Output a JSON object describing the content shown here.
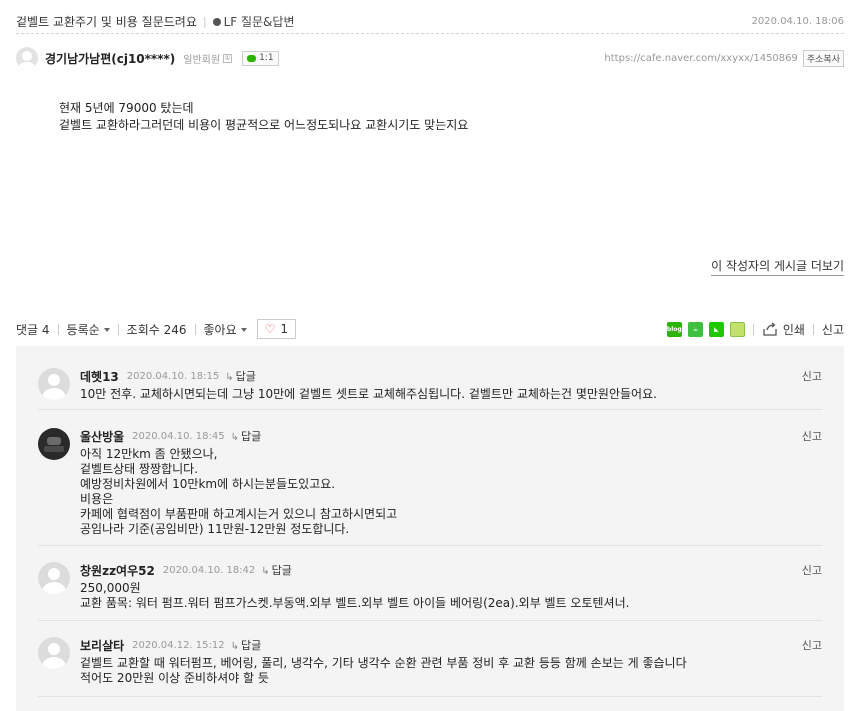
{
  "post": {
    "title": "겉벨트 교환주기 및 비용 질문드려요",
    "board": "LF 질문&답변",
    "date": "2020.04.10. 18:06",
    "author": "경기남가남편(cj10****)",
    "member_grade": "일반회원",
    "grade_icon": "①",
    "chat_label": "1:1",
    "url": "https://cafe.naver.com/xxyxx/1450869",
    "copy_label": "주소복사",
    "body_lines": [
      "현재 5년에 79000 탔는데",
      "겉벨트 교환하라그러던데 비용이 평균적으로 어느정도되나요 교환시기도 맞는지요"
    ],
    "more_link": "이 작성자의 게시글 더보기"
  },
  "stats": {
    "comments_label": "댓글 4",
    "sort_label": "등록순",
    "views_label": "조회수 246",
    "like_label": "좋아요",
    "like_count": "1",
    "print_label": "인쇄",
    "report_label": "신고"
  },
  "share_icons": [
    "blog",
    "cafe",
    "keep",
    "memo"
  ],
  "comments": [
    {
      "name": "데헷13",
      "date": "2020.04.10. 18:15",
      "reply": "답글",
      "report": "신고",
      "avatar": "default",
      "text": "10만 전후. 교체하시면되는데 그냥 10만에 겉벨트 셋트로 교체해주심됩니다. 겉벨트만 교체하는건 몇만원안들어요."
    },
    {
      "name": "울산방울",
      "date": "2020.04.10. 18:45",
      "reply": "답글",
      "report": "신고",
      "avatar": "photo",
      "text": "아직 12만km 좀 안됐으나,\n겉벨트상태 짱짱합니다.\n예방정비차원에서 10만km에 하시는분들도있고요.\n비용은\n카페에 협력점이 부품판매 하고계시는거 있으니 참고하시면되고\n공임나라 기준(공임비만) 11만원-12만원 정도합니다."
    },
    {
      "name": "창원zz여우52",
      "date": "2020.04.10. 18:42",
      "reply": "답글",
      "report": "신고",
      "avatar": "default",
      "text": "250,000원\n교환 품목: 워터 펌프.워터 펌프가스켓.부동액.외부 벨트.외부 벨트 아이들 베어링(2ea).외부 벨트 오토텐셔너."
    },
    {
      "name": "보리살타",
      "date": "2020.04.12. 15:12",
      "reply": "답글",
      "report": "신고",
      "avatar": "default",
      "text": "겉벨트 교환할 때 워터펌프, 베어링, 풀리, 냉각수, 기타 냉각수 순환 관련 부품 정비 후 교환 등등 함께 손보는 게 좋습니다\n적어도 20만원 이상 준비하셔야 할 듯"
    }
  ]
}
